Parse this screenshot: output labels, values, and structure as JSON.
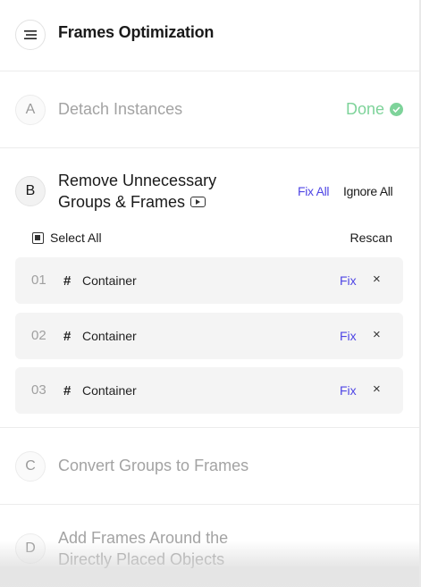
{
  "header": {
    "title": "Frames Optimization",
    "menu_icon": "hamburger-menu-icon"
  },
  "steps": {
    "a": {
      "letter": "A",
      "label": "Detach Instances",
      "status": "Done",
      "status_color": "#7ed39a"
    },
    "b": {
      "letter": "B",
      "title_line1": "Remove Unnecessary",
      "title_line2": "Groups & Frames",
      "fix_all": "Fix All",
      "ignore_all": "Ignore All",
      "select_all": "Select All",
      "rescan": "Rescan",
      "items": [
        {
          "num": "01",
          "icon": "#",
          "name": "Container",
          "fix": "Fix",
          "close": "×"
        },
        {
          "num": "02",
          "icon": "#",
          "name": "Container",
          "fix": "Fix",
          "close": "×"
        },
        {
          "num": "03",
          "icon": "#",
          "name": "Container",
          "fix": "Fix",
          "close": "×"
        }
      ]
    },
    "c": {
      "letter": "C",
      "label": "Convert Groups to Frames"
    },
    "d": {
      "letter": "D",
      "label_line1": "Add Frames Around the",
      "label_line2": "Directly Placed Objects"
    }
  },
  "colors": {
    "accent": "#4f46e5",
    "success": "#7ed39a"
  }
}
